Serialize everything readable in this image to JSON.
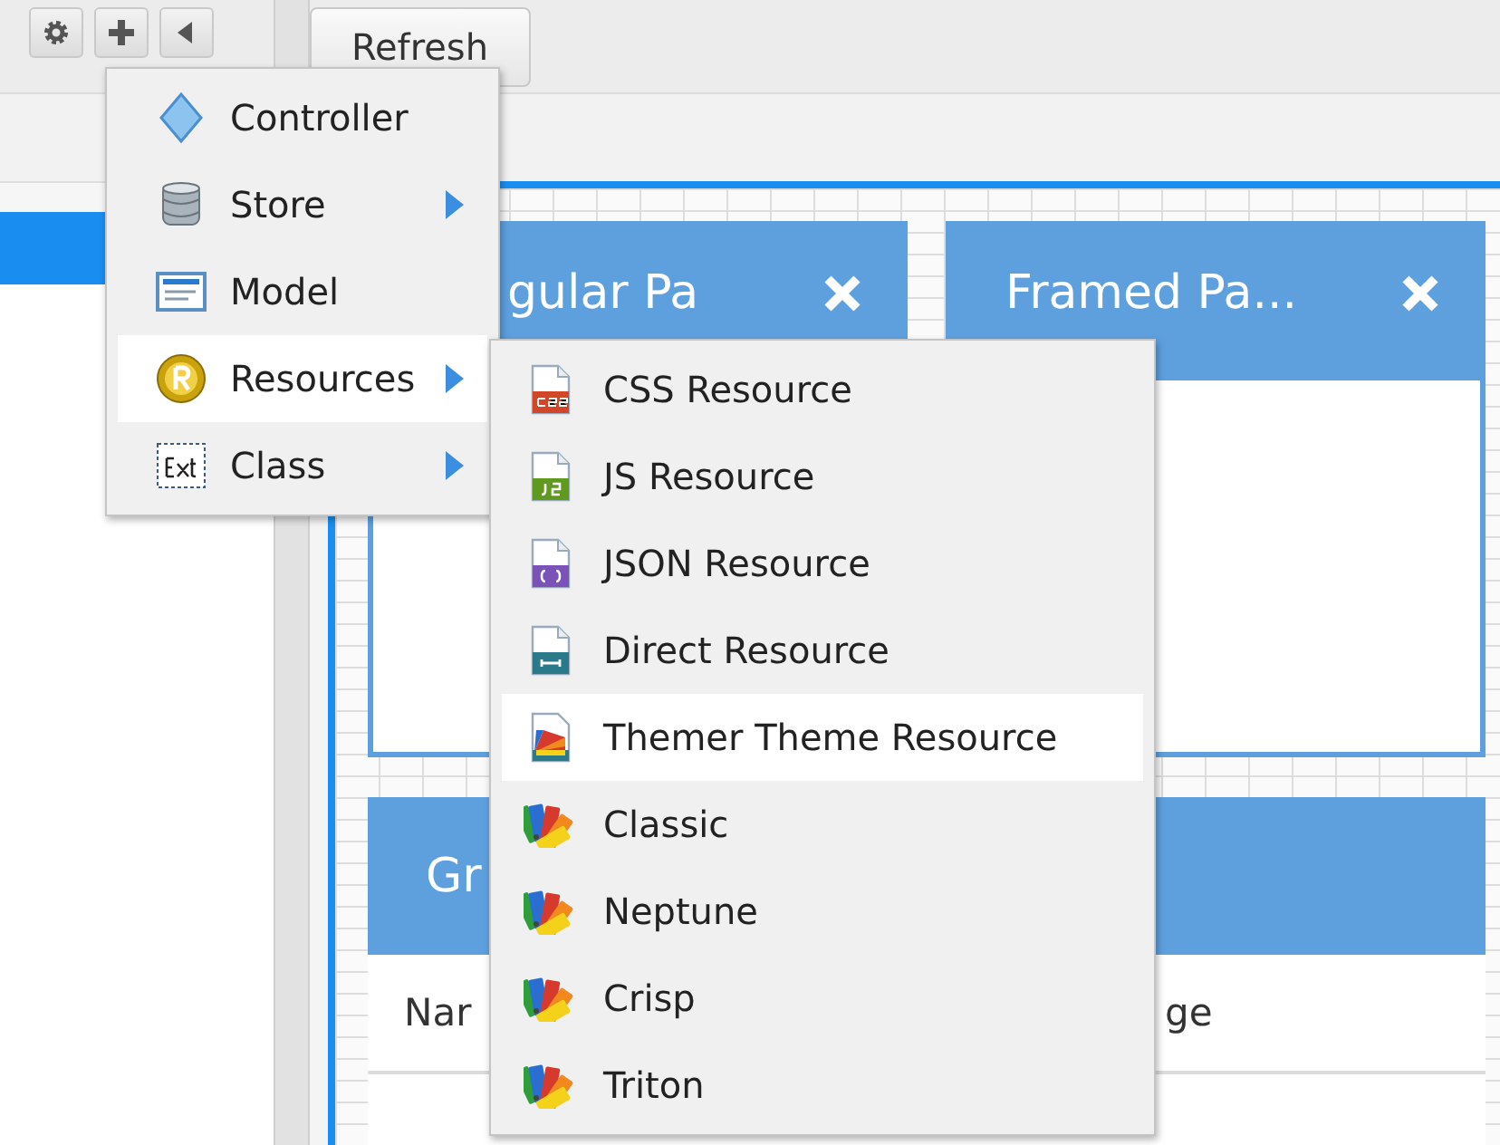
{
  "left_toolbar": {
    "buttons": [
      {
        "kind": "gear"
      },
      {
        "kind": "plus"
      },
      {
        "kind": "back"
      }
    ]
  },
  "toolbar": {
    "refresh_button": "Refresh"
  },
  "canvas": {
    "panels": [
      {
        "title": "gular Pa",
        "closable": true
      },
      {
        "title": "Framed Pa...",
        "closable": true
      }
    ],
    "grid_panel": {
      "title": "Gr",
      "columns": [
        "Nar",
        "ge"
      ]
    }
  },
  "menu": {
    "items": [
      {
        "kind": "controller",
        "label": "Controller",
        "has_submenu": false,
        "selected": false
      },
      {
        "kind": "store",
        "label": "Store",
        "has_submenu": true,
        "selected": false
      },
      {
        "kind": "model",
        "label": "Model",
        "has_submenu": false,
        "selected": false
      },
      {
        "kind": "resources",
        "label": "Resources",
        "has_submenu": true,
        "selected": true
      },
      {
        "kind": "class",
        "label": "Class",
        "has_submenu": true,
        "selected": false
      }
    ]
  },
  "submenu": {
    "items": [
      {
        "kind": "css",
        "label": "CSS Resource",
        "selected": false
      },
      {
        "kind": "js",
        "label": "JS Resource",
        "selected": false
      },
      {
        "kind": "json",
        "label": "JSON Resource",
        "selected": false
      },
      {
        "kind": "direct",
        "label": "Direct Resource",
        "selected": false
      },
      {
        "kind": "themer",
        "label": "Themer Theme Resource",
        "selected": true
      },
      {
        "kind": "theme",
        "label": "Classic",
        "selected": false
      },
      {
        "kind": "theme",
        "label": "Neptune",
        "selected": false
      },
      {
        "kind": "theme",
        "label": "Crisp",
        "selected": false
      },
      {
        "kind": "theme",
        "label": "Triton",
        "selected": false
      }
    ]
  }
}
